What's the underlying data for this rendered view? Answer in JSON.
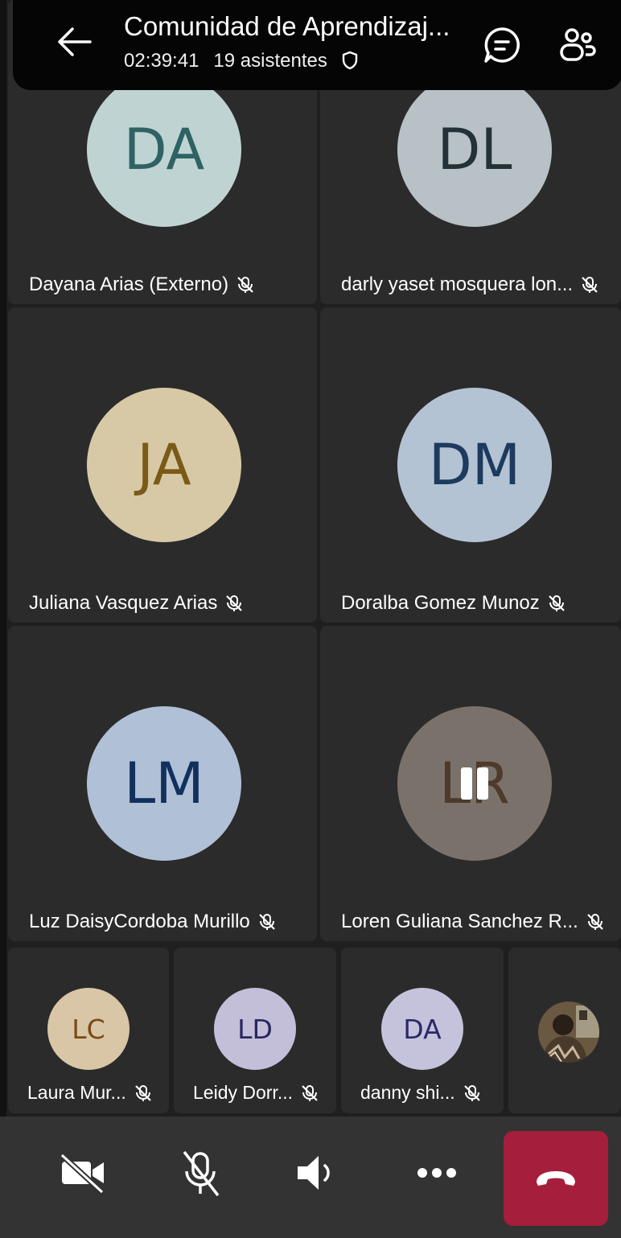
{
  "header": {
    "title": "Comunidad de Aprendizaj...",
    "duration": "02:39:41",
    "attendees": "19 asistentes"
  },
  "participants": [
    {
      "initials": "DA",
      "name": "Dayana Arias (Externo)",
      "avatar_bg": "#c0d3d3",
      "avatar_fg": "#2f6363",
      "muted": true
    },
    {
      "initials": "DL",
      "name": "darly yaset mosquera lon...",
      "avatar_bg": "#b8c1c6",
      "avatar_fg": "#233238",
      "muted": true
    },
    {
      "initials": "JA",
      "name": "Juliana Vasquez Arias",
      "avatar_bg": "#d8c9a6",
      "avatar_fg": "#7a5a17",
      "muted": true
    },
    {
      "initials": "DM",
      "name": "Doralba Gomez Munoz",
      "avatar_bg": "#b4c3d3",
      "avatar_fg": "#1c3b5e",
      "muted": true
    },
    {
      "initials": "LM",
      "name": "Luz DaisyCordoba Murillo",
      "avatar_bg": "#b0c0d6",
      "avatar_fg": "#12305e",
      "muted": true
    },
    {
      "initials": "LR",
      "name": "Loren Guliana Sanchez R...",
      "avatar_bg": "#7a716a",
      "avatar_fg": "#4d3a2a",
      "muted": true,
      "paused": true
    }
  ],
  "small_participants": [
    {
      "initials": "LC",
      "name": "Laura Mur...",
      "avatar_bg": "#d9c6a6",
      "avatar_fg": "#7a4a17",
      "muted": true
    },
    {
      "initials": "LD",
      "name": "Leidy Dorr...",
      "avatar_bg": "#c4bfd9",
      "avatar_fg": "#2a2660",
      "muted": true
    },
    {
      "initials": "DA",
      "name": "danny shi...",
      "avatar_bg": "#c5c3db",
      "avatar_fg": "#2b2a68",
      "muted": true
    }
  ],
  "controls": {
    "camera": "camera-off-icon",
    "mic": "mic-off-icon",
    "speaker": "speaker-icon",
    "more": "more-icon",
    "hangup": "hang-up-icon",
    "hangup_color": "#a51e3b"
  }
}
